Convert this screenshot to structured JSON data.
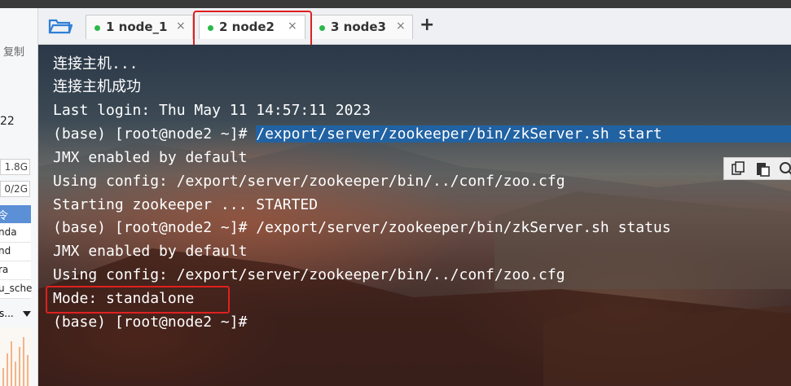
{
  "left_panel": {
    "copy_label": "复制",
    "value_22": "22",
    "mem_field_1": "1.8G",
    "mem_field_2": "0/2G",
    "selected_item": "令",
    "items": [
      "nda",
      "nd",
      "ra",
      "u_sche"
    ],
    "dropdown_label": "s..."
  },
  "tabs": [
    {
      "label": "1 node_1",
      "close": "×",
      "status_color": "#2cb84a"
    },
    {
      "label": "2 node2",
      "close": "×",
      "status_color": "#2cb84a",
      "active": true
    },
    {
      "label": "3 node3",
      "close": "×",
      "status_color": "#2cb84a"
    }
  ],
  "add_tab": "+",
  "terminal": {
    "lines": [
      "连接主机...",
      "连接主机成功",
      "Last login: Thu May 11 14:57:11 2023",
      "(base) [root@node2 ~]# ",
      "JMX enabled by default",
      "Using config: /export/server/zookeeper/bin/../conf/zoo.cfg",
      "Starting zookeeper ... STARTED",
      "(base) [root@node2 ~]# /export/server/zookeeper/bin/zkServer.sh status",
      "JMX enabled by default",
      "Using config: /export/server/zookeeper/bin/../conf/zoo.cfg",
      "Mode: standalone",
      "(base) [root@node2 ~]#"
    ],
    "highlighted_command": "/export/server/zookeeper/bin/zkServer.sh start"
  },
  "icons": {
    "folder": "folder-icon",
    "copy": "copy-icon",
    "paste": "paste-icon",
    "search": "search-icon"
  },
  "colors": {
    "annotation_red": "#e02020",
    "selection_blue": "#2162a3",
    "status_green": "#2cb84a"
  }
}
